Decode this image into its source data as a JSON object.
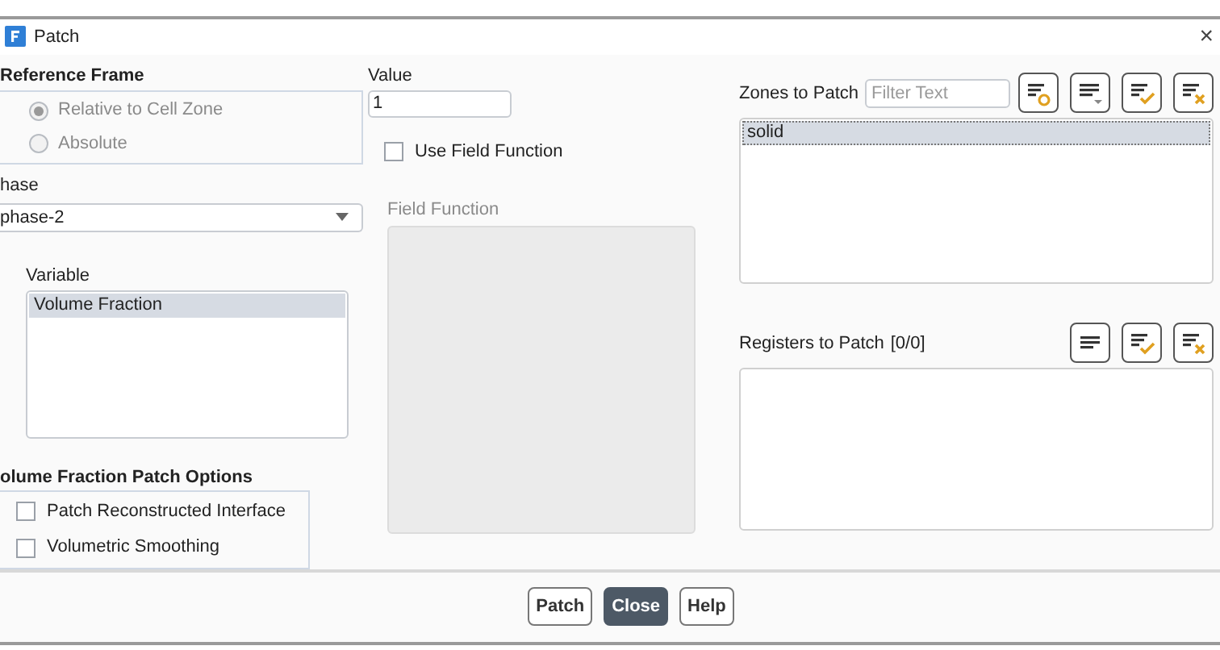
{
  "window": {
    "title": "Patch",
    "close": "×"
  },
  "reference_frame": {
    "label": "Reference Frame",
    "options": [
      {
        "label": "Relative to Cell Zone",
        "selected": true,
        "disabled": true
      },
      {
        "label": "Absolute",
        "selected": false,
        "disabled": true
      }
    ]
  },
  "phase": {
    "label": "hase",
    "value": "phase-2"
  },
  "variable": {
    "label": "Variable",
    "items": [
      {
        "label": "Volume Fraction",
        "selected": true
      }
    ]
  },
  "patch_options": {
    "label": "olume Fraction Patch Options",
    "options": [
      {
        "label": "Patch Reconstructed Interface",
        "checked": false
      },
      {
        "label": "Volumetric Smoothing",
        "checked": false
      }
    ]
  },
  "value": {
    "label": "Value",
    "value": "1"
  },
  "use_field_function": {
    "label": "Use Field Function",
    "checked": false
  },
  "field_function": {
    "label": "Field Function",
    "disabled": true
  },
  "zones": {
    "label": "Zones to Patch",
    "filter_placeholder": "Filter Text",
    "items": [
      {
        "label": "solid",
        "selected": true
      }
    ]
  },
  "registers": {
    "label": "Registers to Patch",
    "count": "[0/0]"
  },
  "buttons": [
    {
      "label": "Patch",
      "default": false
    },
    {
      "label": "Close",
      "default": true
    },
    {
      "label": "Help",
      "default": false
    }
  ]
}
